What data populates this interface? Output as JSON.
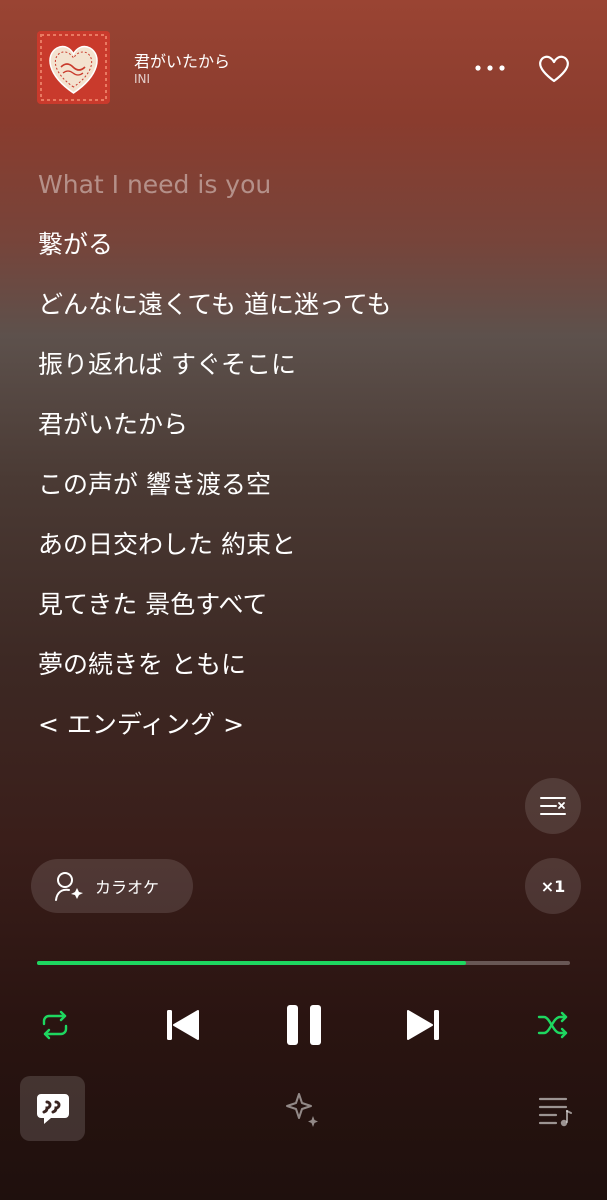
{
  "track": {
    "title": "君がいたから",
    "artist": "INI",
    "cover_icon": "heart-album-art"
  },
  "header": {
    "more_icon": "more-dots-icon",
    "like_icon": "heart-outline-icon"
  },
  "lyrics": [
    "What I need is you",
    "繋がる",
    "どんなに遠くても 道に迷っても",
    "振り返れば すぐそこに",
    "君がいたから",
    "この声が 響き渡る空",
    "あの日交わした 約束と",
    "見てきた 景色すべて",
    "夢の続きを ともに",
    "< エンディング >"
  ],
  "karaoke": {
    "label": "カラオケ"
  },
  "speed": {
    "label": "×1"
  },
  "progress": {
    "fraction": 0.805
  },
  "colors": {
    "accent_green": "#1ed760",
    "cover_red": "#c8372c"
  }
}
